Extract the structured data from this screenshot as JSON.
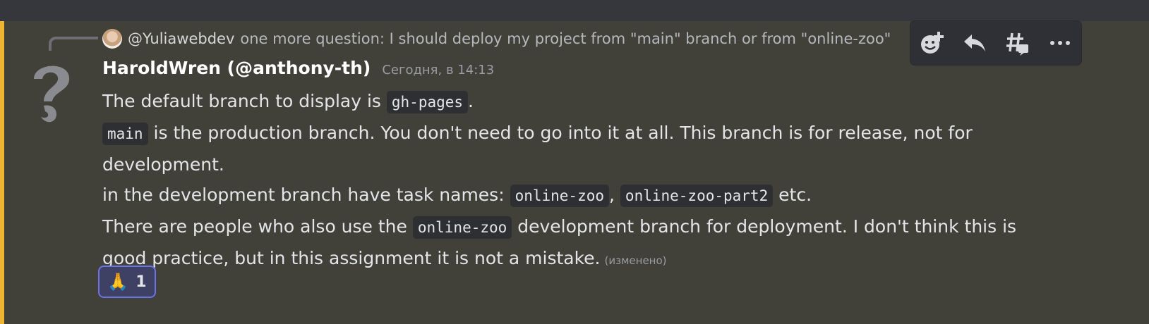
{
  "reply": {
    "mention": "@Yuliawebdev",
    "preview": "one more question: I should deploy my project from \"main\" branch or from \"online-zoo\""
  },
  "message": {
    "author": "HaroldWren (@anthony-th)",
    "timestamp": "Сегодня, в 14:13",
    "edited_label": "(изменено)",
    "line1": {
      "before": "The default branch to display is ",
      "code": "gh-pages",
      "after": "."
    },
    "line2": {
      "code": "main",
      "after": " is the production branch. You don't need to go into it at all. This branch is for release, not for development."
    },
    "line3": {
      "before": "in the development branch have task names: ",
      "code1": "online-zoo",
      "mid": ", ",
      "code2": "online-zoo-part2",
      "after": " etc."
    },
    "line4": {
      "before": "There are people who also use the ",
      "code": "online-zoo",
      "after": " development branch for deployment. I don't think this is good practice, but in this assignment it is not a mistake."
    }
  },
  "reaction": {
    "emoji": "🙏",
    "count": "1"
  },
  "toolbar": {
    "icons": [
      "add-reaction-icon",
      "reply-icon",
      "create-thread-icon",
      "more-icon"
    ]
  },
  "colors": {
    "accent_bar": "#f0b232",
    "message_bg": "#424139",
    "reaction_border": "#6c72e8"
  }
}
